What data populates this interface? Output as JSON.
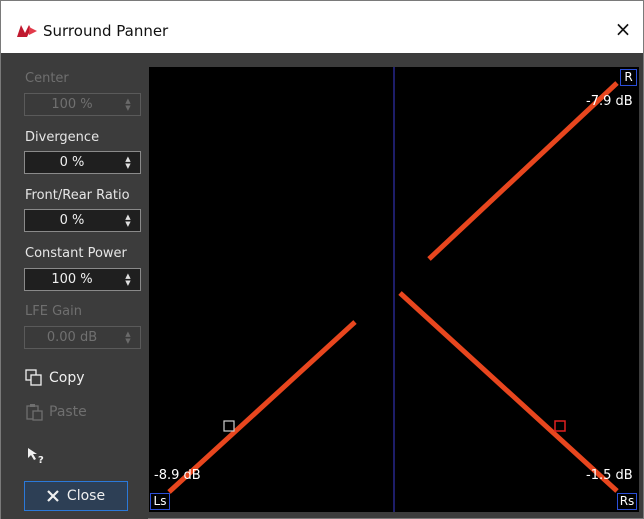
{
  "window": {
    "title": "Surround Panner",
    "close_icon": "×"
  },
  "controls": {
    "center": {
      "label": "Center",
      "value": "100 %",
      "enabled": false
    },
    "divergence": {
      "label": "Divergence",
      "value": "0 %",
      "enabled": true
    },
    "front_rear": {
      "label": "Front/Rear Ratio",
      "value": "0 %",
      "enabled": true
    },
    "constant_power": {
      "label": "Constant Power",
      "value": "100 %",
      "enabled": true
    },
    "lfe_gain": {
      "label": "LFE Gain",
      "value": "0.00 dB",
      "enabled": false
    }
  },
  "buttons": {
    "copy": "Copy",
    "paste": "Paste",
    "close": "Close"
  },
  "panner": {
    "speakers": {
      "L": "Ls",
      "R": "R",
      "Rs": "Rs"
    },
    "levels": {
      "R": "-7.9 dB",
      "Ls": "-8.9 dB",
      "Rs": "-1.5 dB"
    }
  },
  "colors": {
    "accent": "#2b79d9",
    "line": "#e8461e",
    "background": "#000000"
  }
}
